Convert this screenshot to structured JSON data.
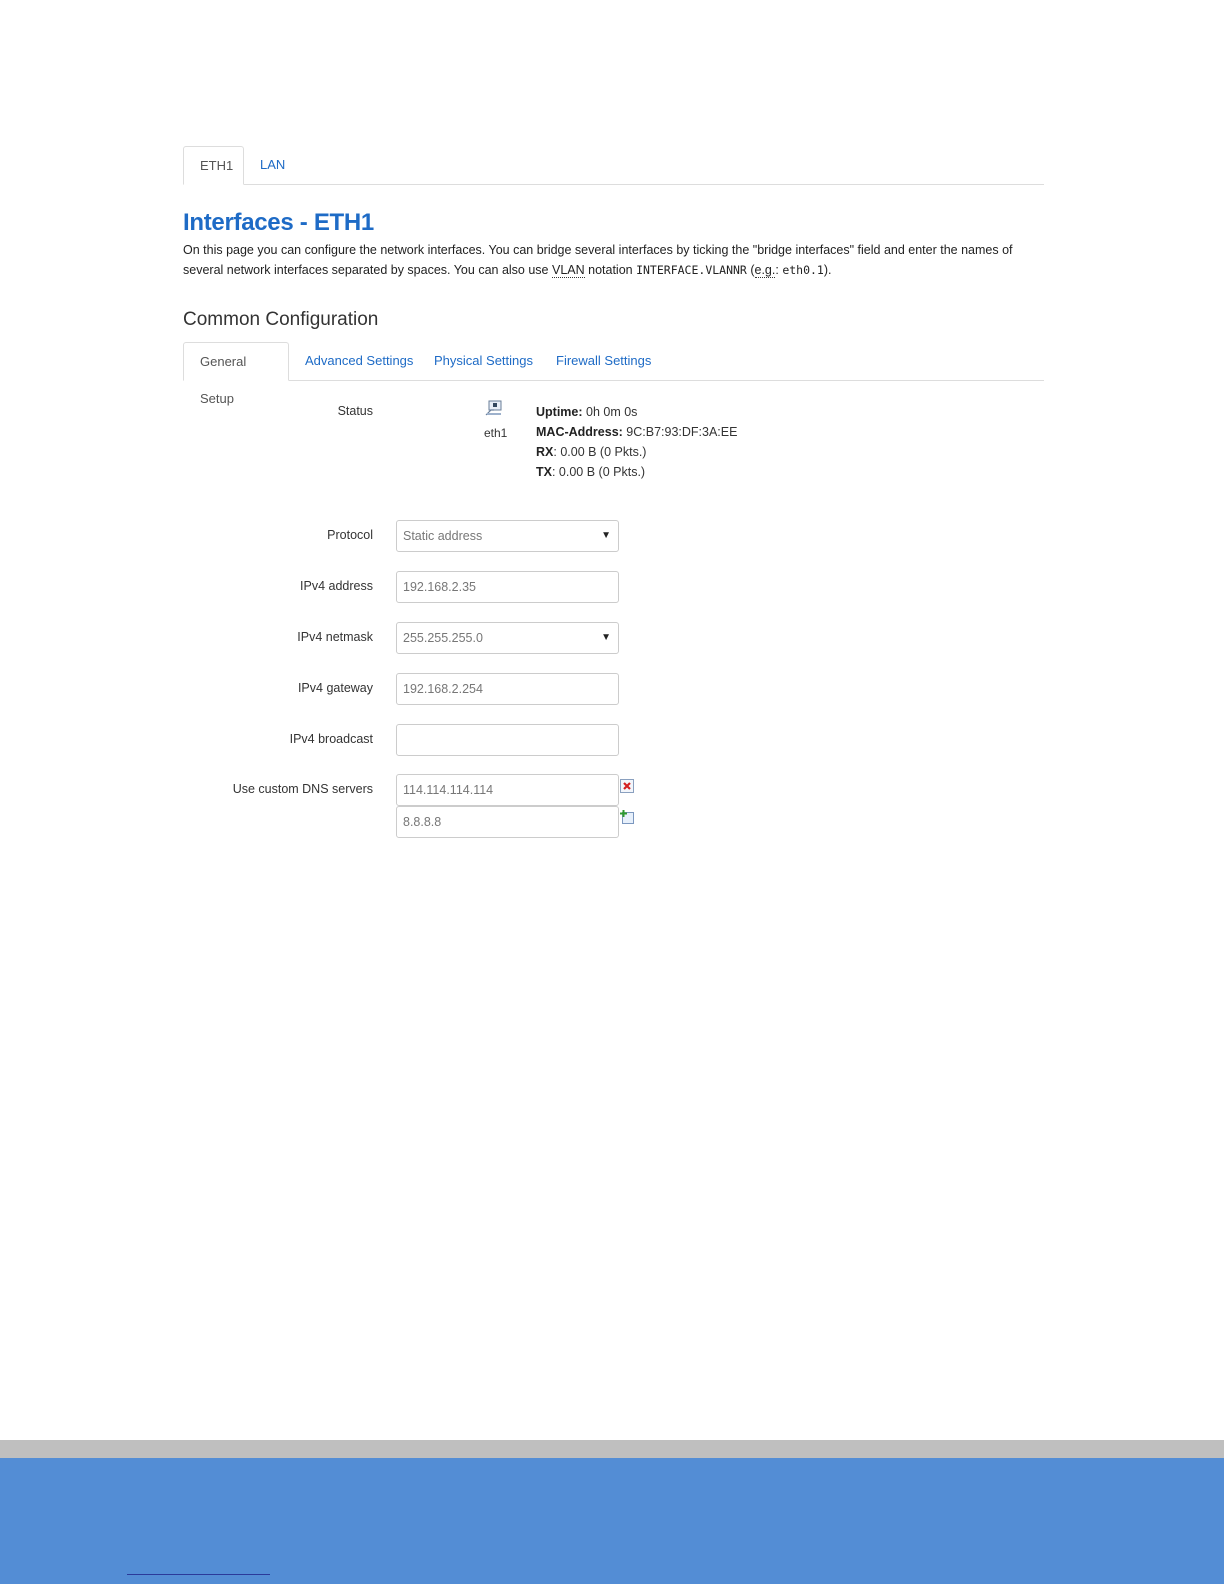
{
  "top_tabs": [
    {
      "label": "ETH1",
      "active": true
    },
    {
      "label": "LAN",
      "active": false
    }
  ],
  "page": {
    "title": "Interfaces - ETH1",
    "desc_part1": "On this page you can configure the network interfaces. You can bridge several interfaces by ticking the \"bridge interfaces\" field and enter the names of several network interfaces separated by spaces. You can also use ",
    "desc_vlan": "VLAN",
    "desc_part2": " notation ",
    "desc_code1": "INTERFACE.VLANNR",
    "desc_part3": " (",
    "desc_eg": "e.g.",
    "desc_part4": ": ",
    "desc_code2": "eth0.1",
    "desc_part5": ")."
  },
  "section_title": "Common Configuration",
  "sub_tabs": [
    {
      "label": "General Setup",
      "active": true
    },
    {
      "label": "Advanced Settings",
      "active": false
    },
    {
      "label": "Physical Settings",
      "active": false
    },
    {
      "label": "Firewall Settings",
      "active": false
    }
  ],
  "status": {
    "label": "Status",
    "iface": "eth1",
    "uptime_label": "Uptime:",
    "uptime_value": " 0h 0m 0s",
    "mac_label": "MAC-Address:",
    "mac_value": " 9C:B7:93:DF:3A:EE",
    "rx_label": "RX",
    "rx_value": ": 0.00 B (0 Pkts.)",
    "tx_label": "TX",
    "tx_value": ": 0.00 B (0 Pkts.)"
  },
  "form": {
    "protocol_label": "Protocol",
    "protocol_value": "Static address",
    "ipv4_address_label": "IPv4 address",
    "ipv4_address_value": "192.168.2.35",
    "ipv4_netmask_label": "IPv4 netmask",
    "ipv4_netmask_value": "255.255.255.0",
    "ipv4_gateway_label": "IPv4 gateway",
    "ipv4_gateway_value": "192.168.2.254",
    "ipv4_broadcast_label": "IPv4 broadcast",
    "ipv4_broadcast_value": "",
    "dns_label": "Use custom DNS servers",
    "dns_values": [
      "114.114.114.114",
      "8.8.8.8"
    ]
  },
  "colors": {
    "link": "#1e6bc6",
    "footer_blue": "#538dd5",
    "footer_gray": "#bfbfbf"
  }
}
